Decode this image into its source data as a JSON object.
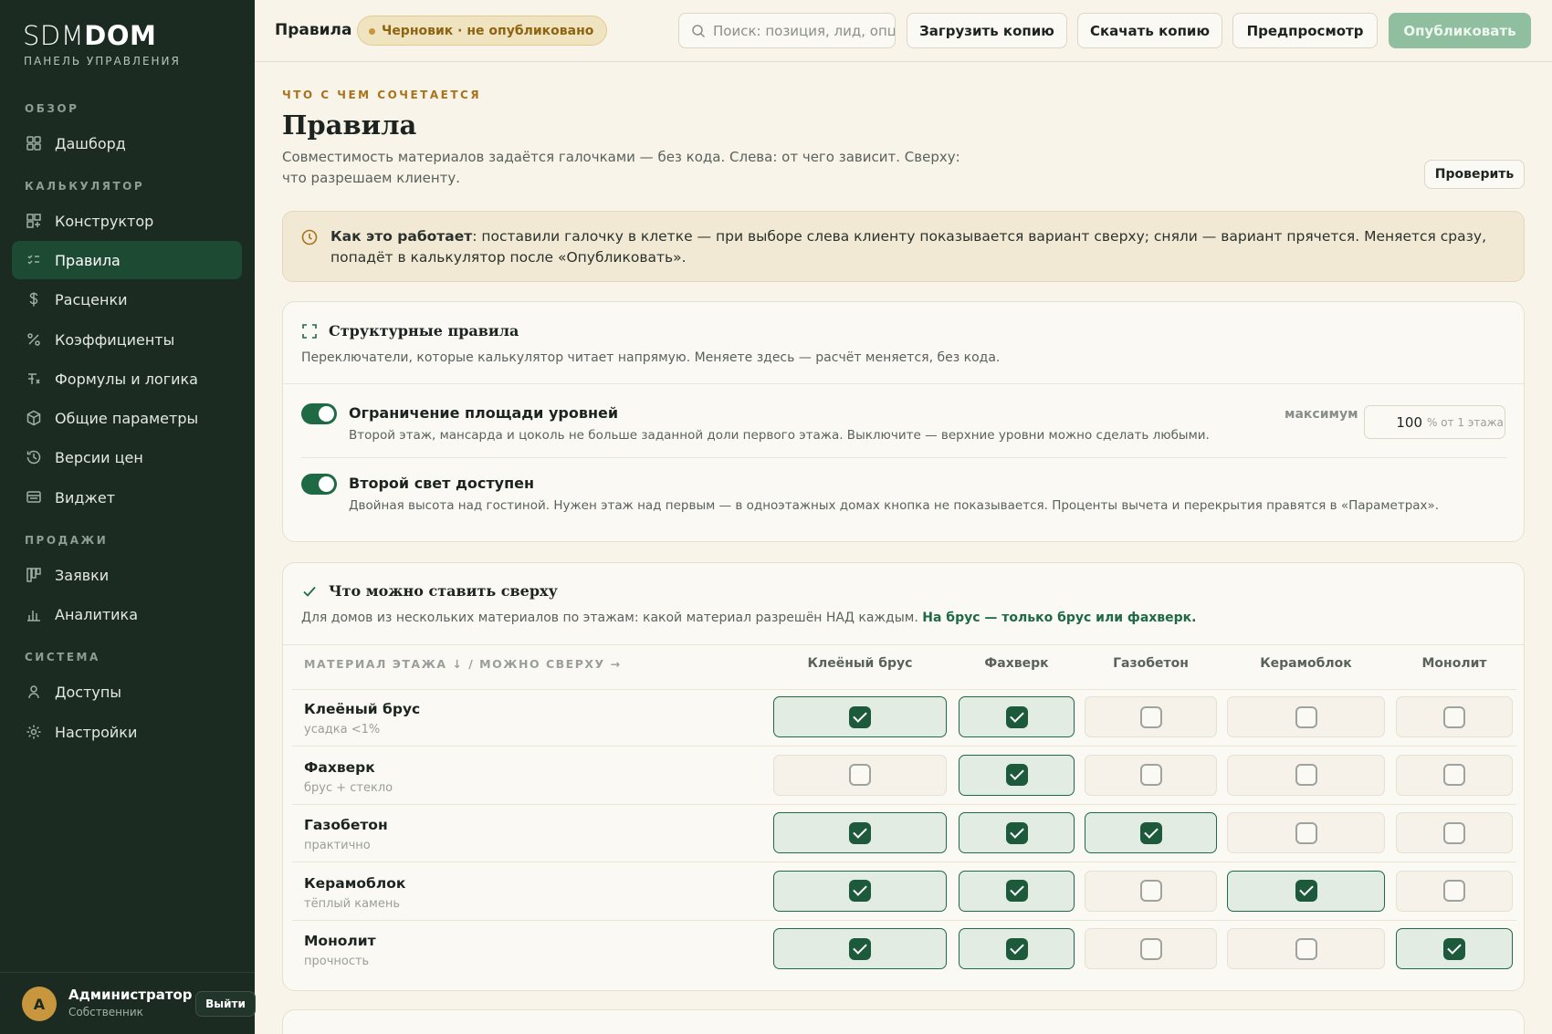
{
  "sidebar": {
    "logo_light": "SDM",
    "logo_bold": "DOM",
    "logo_sub": "ПАНЕЛЬ УПРАВЛЕНИЯ",
    "sections": [
      "ОБЗОР",
      "КАЛЬКУЛЯТОР",
      "ПРОДАЖИ",
      "СИСТЕМА"
    ],
    "items": [
      {
        "label": "Дашборд",
        "icon": "grid-icon"
      },
      {
        "label": "Конструктор",
        "icon": "blocks-icon"
      },
      {
        "label": "Правила",
        "icon": "list-check-icon",
        "active": true
      },
      {
        "label": "Расценки",
        "icon": "dollar-icon"
      },
      {
        "label": "Коэффициенты",
        "icon": "percent-icon"
      },
      {
        "label": "Формулы и логика",
        "icon": "function-icon"
      },
      {
        "label": "Общие параметры",
        "icon": "cube-icon"
      },
      {
        "label": "Версии цен",
        "icon": "history-icon"
      },
      {
        "label": "Виджет",
        "icon": "widget-icon"
      },
      {
        "label": "Заявки",
        "icon": "kanban-icon"
      },
      {
        "label": "Аналитика",
        "icon": "bar-chart-icon"
      },
      {
        "label": "Доступы",
        "icon": "user-icon"
      },
      {
        "label": "Настройки",
        "icon": "gear-icon"
      }
    ],
    "user": {
      "initial": "А",
      "name": "Администратор",
      "role": "Собственник",
      "logout": "Выйти"
    }
  },
  "topbar": {
    "title": "Правила",
    "status": "Черновик · не опубликовано",
    "search_placeholder": "Поиск: позиция, лид, опц",
    "upload": "Загрузить копию",
    "download": "Скачать копию",
    "preview": "Предпросмотр",
    "publish": "Опубликовать"
  },
  "page": {
    "eyebrow": "ЧТО С ЧЕМ СОЧЕТАЕТСЯ",
    "title": "Правила",
    "description": "Совместимость материалов задаётся галочками — без кода. Слева: от чего зависит. Сверху: что разрешаем клиенту.",
    "check_button": "Проверить"
  },
  "info": {
    "bold": "Как это работает",
    "text": ": поставили галочку в клетке — при выборе слева клиенту показывается вариант сверху; сняли — вариант прячется. Меняется сразу, попадёт в калькулятор после «Опубликовать»."
  },
  "structural": {
    "title": "Структурные правила",
    "subtitle": "Переключатели, которые калькулятор читает напрямую. Меняете здесь — расчёт меняется, без кода.",
    "toggles": [
      {
        "title": "Ограничение площади уровней",
        "desc": "Второй этаж, мансарда и цоколь не больше заданной доли первого этажа. Выключите — верхние уровни можно сделать любыми.",
        "on": true
      },
      {
        "title": "Второй свет доступен",
        "desc": "Двойная высота над гостиной. Нужен этаж над первым — в одноэтажных домах кнопка не показывается. Проценты вычета и перекрытия правятся в «Параметрах».",
        "on": true
      }
    ],
    "max_label": "максимум",
    "max_value": "100",
    "max_unit": "% от 1 этажа"
  },
  "matrix": {
    "title": "Что можно ставить сверху",
    "subtitle": "Для домов из нескольких материалов по этажам: какой материал разрешён НАД каждым.",
    "subtitle_accent": "На брус — только брус или фахверк.",
    "corner_label": "МАТЕРИАЛ ЭТАЖА ↓ / МОЖНО СВЕРХУ →",
    "columns": [
      "Клеёный брус",
      "Фахверк",
      "Газобетон",
      "Керамоблок",
      "Монолит"
    ],
    "rows": [
      {
        "name": "Клеёный брус",
        "sub": "усадка <1%",
        "checks": [
          true,
          true,
          false,
          false,
          false
        ]
      },
      {
        "name": "Фахверк",
        "sub": "брус + стекло",
        "checks": [
          false,
          true,
          false,
          false,
          false
        ]
      },
      {
        "name": "Газобетон",
        "sub": "практично",
        "checks": [
          true,
          true,
          true,
          false,
          false
        ]
      },
      {
        "name": "Керамоблок",
        "sub": "тёплый камень",
        "checks": [
          true,
          true,
          false,
          true,
          false
        ]
      },
      {
        "name": "Монолит",
        "sub": "прочность",
        "checks": [
          true,
          true,
          false,
          false,
          true
        ]
      }
    ]
  },
  "colors": {
    "sidebar": "#1b2b22",
    "accent": "#1d6a45",
    "warning": "#c8963c",
    "page_bg": "#f8f4ea"
  }
}
